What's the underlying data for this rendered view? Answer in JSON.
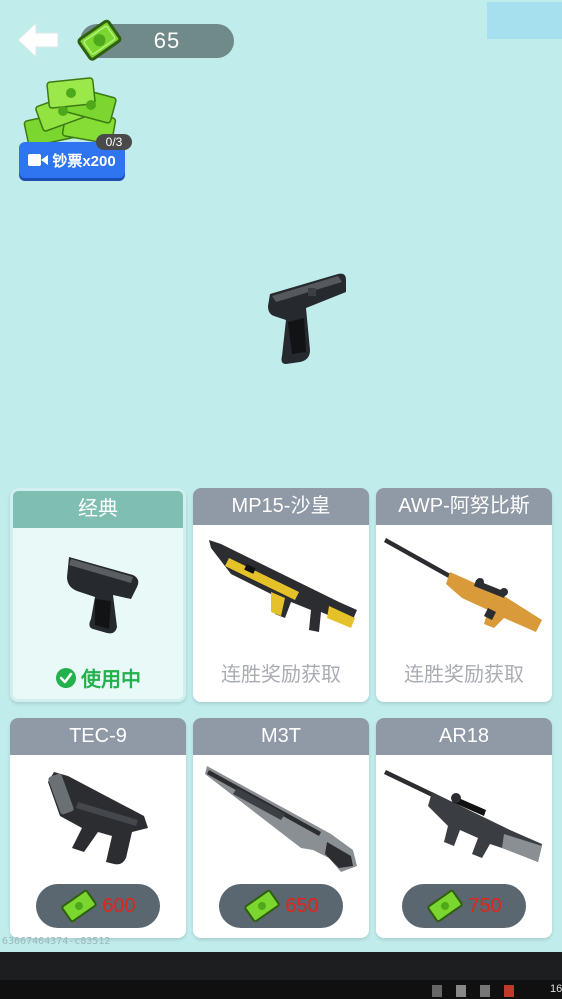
{
  "top_bar": {
    "cash_value": "65"
  },
  "reward": {
    "count": "0/3",
    "button_label": "钞票x200"
  },
  "weapons": [
    {
      "name": "经典",
      "status": "使用中",
      "price": ""
    },
    {
      "name": "MP15-沙皇",
      "status": "连胜奖励获取",
      "price": ""
    },
    {
      "name": "AWP-阿努比斯",
      "status": "连胜奖励获取",
      "price": ""
    },
    {
      "name": "TEC-9",
      "status": "",
      "price": "600"
    },
    {
      "name": "M3T",
      "status": "",
      "price": "650"
    },
    {
      "name": "AR18",
      "status": "",
      "price": "750"
    }
  ],
  "debug_text": "63667464374-c83512",
  "clock_fragment": "16",
  "colors": {
    "background": "#c0ecec",
    "card_header": "#8f9aa6",
    "card_header_selected": "#7ebfb1",
    "in_use": "#22b14c",
    "price": "#e0261b",
    "reward_button": "#2f74f0"
  },
  "icons": [
    "back-arrow-icon",
    "cash-icon",
    "money-pile-icon",
    "video-icon",
    "check-icon",
    "pistol-icon",
    "rifle-icon",
    "sniper-icon",
    "smg-icon",
    "shotgun-icon"
  ]
}
